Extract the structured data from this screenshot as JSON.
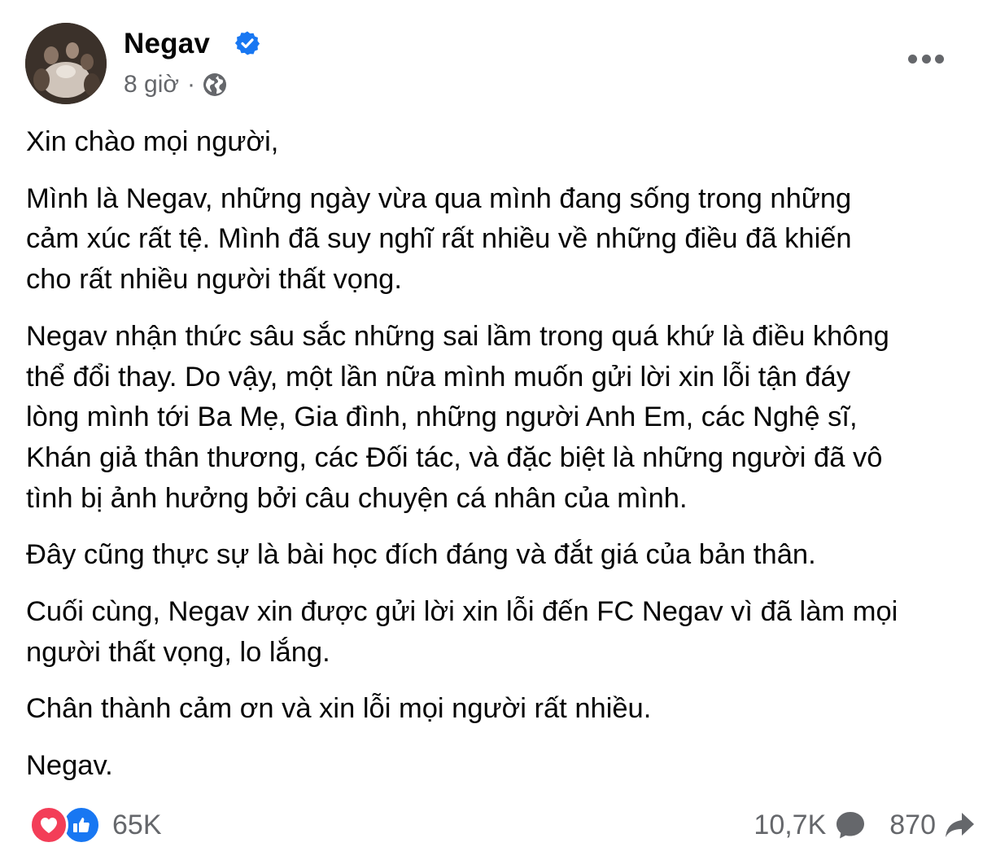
{
  "post": {
    "author": "Negav",
    "time": "8 giờ",
    "separator": "·",
    "paragraphs": [
      "Xin chào mọi người,",
      "Mình là Negav, những ngày vừa qua mình đang sống trong những\ncảm xúc rất tệ. Mình đã suy nghĩ rất nhiều về những điều đã khiến\ncho rất nhiều người thất vọng.",
      "Negav nhận thức sâu sắc những sai lầm trong quá khứ là điều không\nthể đổi thay. Do vậy, một lần nữa mình muốn gửi lời xin lỗi tận đáy\nlòng mình tới Ba Mẹ, Gia đình, những người Anh Em, các Nghệ sĩ,\nKhán giả thân thương, các Đối tác, và đặc biệt là những người đã vô\ntình bị ảnh hưởng bởi câu chuyện cá nhân của mình.",
      "Đây cũng thực sự là bài học đích đáng và đắt giá của bản thân.",
      "Cuối cùng, Negav xin được gửi lời xin lỗi đến FC Negav vì đã làm mọi\nngười thất vọng, lo lắng.",
      "Chân thành cảm ơn và xin lỗi mọi người rất nhiều.",
      "Negav."
    ]
  },
  "footer": {
    "reaction_count": "65K",
    "comment_count": "10,7K",
    "share_count": "870"
  },
  "icons": [
    "verified-badge-icon",
    "globe-icon",
    "more-options-icon",
    "love-reaction-icon",
    "like-reaction-icon",
    "comment-icon",
    "share-icon"
  ],
  "colors": {
    "verified": "#1877f2",
    "like": "#1877f2",
    "love": "#f33e58",
    "secondary_text": "#65676b",
    "primary_text": "#050505"
  }
}
